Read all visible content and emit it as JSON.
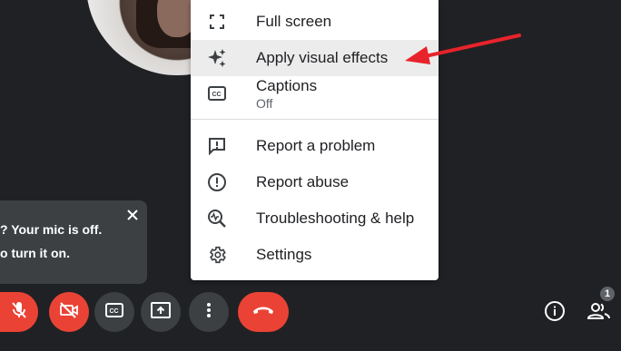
{
  "menu": {
    "items": [
      {
        "label": "Full screen",
        "icon": "fullscreen-icon"
      },
      {
        "label": "Apply visual effects",
        "icon": "sparkle-icon"
      },
      {
        "label": "Captions",
        "sublabel": "Off",
        "icon": "captions-icon"
      },
      {
        "label": "Report a problem",
        "icon": "feedback-icon"
      },
      {
        "label": "Report abuse",
        "icon": "report-abuse-icon"
      },
      {
        "label": "Troubleshooting & help",
        "icon": "troubleshoot-icon"
      },
      {
        "label": "Settings",
        "icon": "gear-icon"
      }
    ]
  },
  "tooltip": {
    "line1": "? Your mic is off.",
    "line2": "o turn it on."
  },
  "participants": {
    "count": "1"
  },
  "colors": {
    "accent_red": "#ea4335",
    "control_gray": "#3c4043",
    "background": "#202124",
    "annotation_arrow": "#e8232b"
  }
}
